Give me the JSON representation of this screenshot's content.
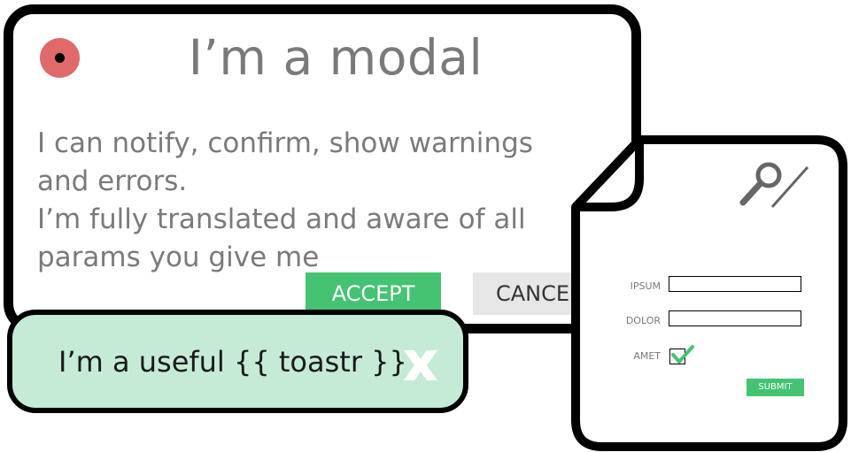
{
  "modal": {
    "title": "I’m a modal",
    "body_lines": [
      "I can notify, confirm, show warnings",
      "and errors.",
      "I’m fully translated and aware of all",
      "params you give me"
    ],
    "accept_label": "ACCEPT",
    "cancel_label": "CANCEL",
    "indicator_icon": "record-dot-icon",
    "accent_color": "#e06a6a"
  },
  "toastr": {
    "message": "I’m a useful {{ toastr }}",
    "close_icon": "close-x-icon",
    "background_color": "#c5ebd6"
  },
  "form": {
    "header_icon": "magnifier-pencil-icon",
    "fields": [
      {
        "label": "IPSUM",
        "value": ""
      },
      {
        "label": "DOLOR",
        "value": ""
      }
    ],
    "checkbox": {
      "label": "AMET",
      "checked": true
    },
    "submit_label": "SUBMIT",
    "button_color": "#45c373"
  }
}
